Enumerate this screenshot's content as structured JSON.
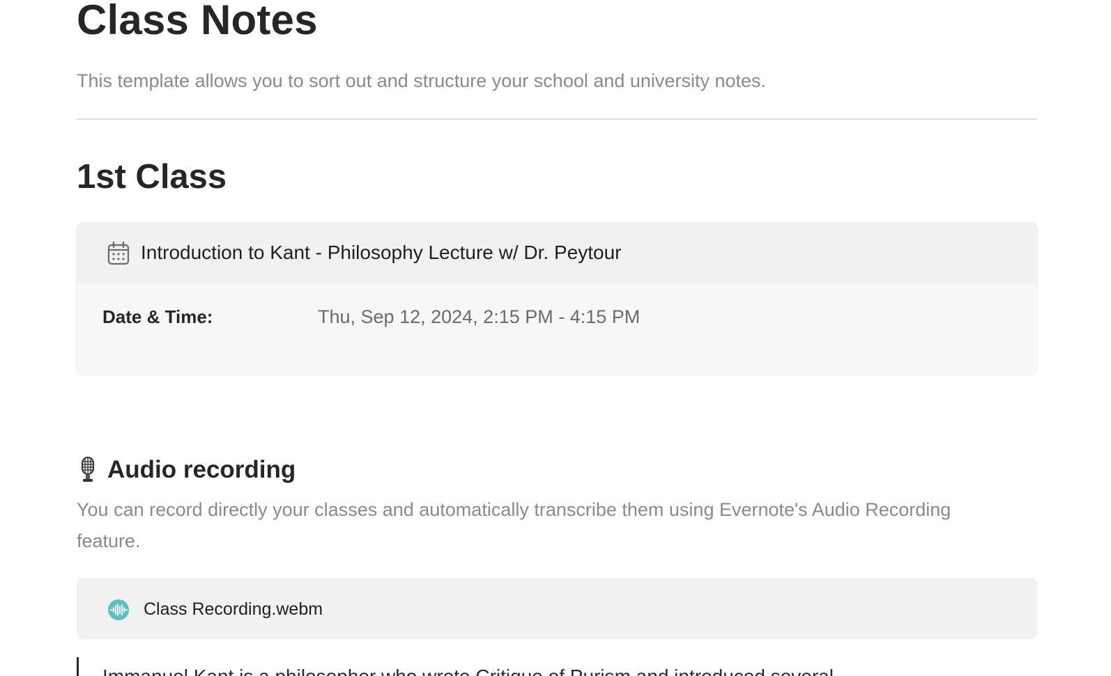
{
  "page": {
    "title": "Class Notes",
    "subtitle": "This template allows you to sort out and structure your school and university notes."
  },
  "section": {
    "heading": "1st Class"
  },
  "event": {
    "icon": "calendar-icon",
    "title": "Introduction to Kant - Philosophy Lecture w/ Dr. Peytour",
    "property_label": "Date & Time:",
    "property_value": "Thu, Sep 12, 2024, 2:15 PM - 4:15 PM"
  },
  "audio": {
    "icon": "microphone-icon",
    "heading": "Audio recording",
    "description": "You can record directly your classes and automatically transcribe them using Evernote's Audio Recording feature.",
    "file": {
      "icon": "audio-waveform-icon",
      "name": "Class Recording.webm",
      "icon_color": "#5ebfbf"
    }
  },
  "quote": {
    "text": "Immanuel Kant is a philosopher who wrote Critique of Purism and introduced several"
  }
}
